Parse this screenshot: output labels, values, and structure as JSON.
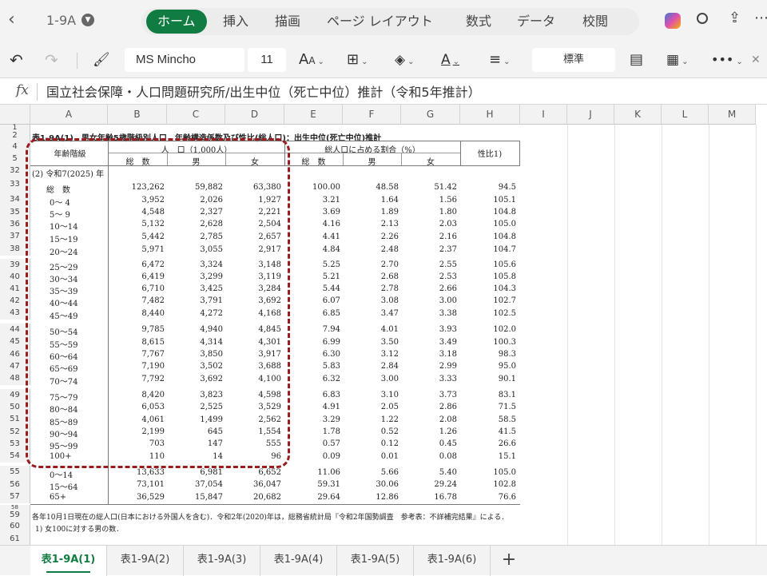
{
  "app": {
    "doc_title": "1-9A",
    "ribbon_tabs": [
      "ホーム",
      "挿入",
      "描画",
      "ページ レイアウト",
      "数式",
      "データ",
      "校閲"
    ]
  },
  "toolbar": {
    "font_name": "MS Mincho",
    "font_size": "11",
    "number_format": "標準"
  },
  "formula_bar": {
    "fx_label": "fx",
    "content": "国立社会保障・人口問題研究所/出生中位（死亡中位）推計（令和5年推計）"
  },
  "columns": [
    "A",
    "B",
    "C",
    "D",
    "E",
    "F",
    "G",
    "H",
    "I",
    "J",
    "K",
    "L",
    "M"
  ],
  "sheet": {
    "title": "表1-9A(1)　男女年齢5歳階級別人口，年齢構造係数及び性比(総人口)：出生中位(死亡中位)推計",
    "headers": {
      "age_group": "年齢階級",
      "population": "人　口（1,000人）",
      "share": "総人口に占める割合（%）",
      "sex_ratio": "性比1)",
      "total": "総　数",
      "male": "男",
      "female": "女"
    },
    "section_label": "(2) 令和7(2025) 年",
    "rows": [
      {
        "num": "33",
        "age": "総　数",
        "t": "123,262",
        "m": "59,882",
        "f": "63,380",
        "pt": "100.00",
        "pm": "48.58",
        "pf": "51.42",
        "r": "94.5"
      },
      {
        "num": "34",
        "age": "0～ 4",
        "t": "3,952",
        "m": "2,026",
        "f": "1,927",
        "pt": "3.21",
        "pm": "1.64",
        "pf": "1.56",
        "r": "105.1"
      },
      {
        "num": "35",
        "age": "5～ 9",
        "t": "4,548",
        "m": "2,327",
        "f": "2,221",
        "pt": "3.69",
        "pm": "1.89",
        "pf": "1.80",
        "r": "104.8"
      },
      {
        "num": "36",
        "age": "10～14",
        "t": "5,132",
        "m": "2,628",
        "f": "2,504",
        "pt": "4.16",
        "pm": "2.13",
        "pf": "2.03",
        "r": "105.0"
      },
      {
        "num": "37",
        "age": "15～19",
        "t": "5,442",
        "m": "2,785",
        "f": "2,657",
        "pt": "4.41",
        "pm": "2.26",
        "pf": "2.16",
        "r": "104.8"
      },
      {
        "num": "38",
        "age": "20～24",
        "t": "5,971",
        "m": "3,055",
        "f": "2,917",
        "pt": "4.84",
        "pm": "2.48",
        "pf": "2.37",
        "r": "104.7"
      },
      {
        "num": "39",
        "age": "25～29",
        "t": "6,472",
        "m": "3,324",
        "f": "3,148",
        "pt": "5.25",
        "pm": "2.70",
        "pf": "2.55",
        "r": "105.6"
      },
      {
        "num": "40",
        "age": "30～34",
        "t": "6,419",
        "m": "3,299",
        "f": "3,119",
        "pt": "5.21",
        "pm": "2.68",
        "pf": "2.53",
        "r": "105.8"
      },
      {
        "num": "41",
        "age": "35～39",
        "t": "6,710",
        "m": "3,425",
        "f": "3,284",
        "pt": "5.44",
        "pm": "2.78",
        "pf": "2.66",
        "r": "104.3"
      },
      {
        "num": "42",
        "age": "40～44",
        "t": "7,482",
        "m": "3,791",
        "f": "3,692",
        "pt": "6.07",
        "pm": "3.08",
        "pf": "3.00",
        "r": "102.7"
      },
      {
        "num": "43",
        "age": "45～49",
        "t": "8,440",
        "m": "4,272",
        "f": "4,168",
        "pt": "6.85",
        "pm": "3.47",
        "pf": "3.38",
        "r": "102.5"
      },
      {
        "num": "44",
        "age": "50～54",
        "t": "9,785",
        "m": "4,940",
        "f": "4,845",
        "pt": "7.94",
        "pm": "4.01",
        "pf": "3.93",
        "r": "102.0"
      },
      {
        "num": "45",
        "age": "55～59",
        "t": "8,615",
        "m": "4,314",
        "f": "4,301",
        "pt": "6.99",
        "pm": "3.50",
        "pf": "3.49",
        "r": "100.3"
      },
      {
        "num": "46",
        "age": "60～64",
        "t": "7,767",
        "m": "3,850",
        "f": "3,917",
        "pt": "6.30",
        "pm": "3.12",
        "pf": "3.18",
        "r": "98.3"
      },
      {
        "num": "47",
        "age": "65～69",
        "t": "7,190",
        "m": "3,502",
        "f": "3,688",
        "pt": "5.83",
        "pm": "2.84",
        "pf": "2.99",
        "r": "95.0"
      },
      {
        "num": "48",
        "age": "70～74",
        "t": "7,792",
        "m": "3,692",
        "f": "4,100",
        "pt": "6.32",
        "pm": "3.00",
        "pf": "3.33",
        "r": "90.1"
      },
      {
        "num": "49",
        "age": "75～79",
        "t": "8,420",
        "m": "3,823",
        "f": "4,598",
        "pt": "6.83",
        "pm": "3.10",
        "pf": "3.73",
        "r": "83.1"
      },
      {
        "num": "50",
        "age": "80～84",
        "t": "6,053",
        "m": "2,525",
        "f": "3,529",
        "pt": "4.91",
        "pm": "2.05",
        "pf": "2.86",
        "r": "71.5"
      },
      {
        "num": "51",
        "age": "85～89",
        "t": "4,061",
        "m": "1,499",
        "f": "2,562",
        "pt": "3.29",
        "pm": "1.22",
        "pf": "2.08",
        "r": "58.5"
      },
      {
        "num": "52",
        "age": "90～94",
        "t": "2,199",
        "m": "645",
        "f": "1,554",
        "pt": "1.78",
        "pm": "0.52",
        "pf": "1.26",
        "r": "41.5"
      },
      {
        "num": "53",
        "age": "95～99",
        "t": "703",
        "m": "147",
        "f": "555",
        "pt": "0.57",
        "pm": "0.12",
        "pf": "0.45",
        "r": "26.6"
      },
      {
        "num": "54",
        "age": "100+",
        "t": "110",
        "m": "14",
        "f": "96",
        "pt": "0.09",
        "pm": "0.01",
        "pf": "0.08",
        "r": "15.1"
      },
      {
        "num": "55",
        "age": "0～14",
        "t": "13,633",
        "m": "6,981",
        "f": "6,652",
        "pt": "11.06",
        "pm": "5.66",
        "pf": "5.40",
        "r": "105.0"
      },
      {
        "num": "56",
        "age": "15～64",
        "t": "73,101",
        "m": "37,054",
        "f": "36,047",
        "pt": "59.31",
        "pm": "30.06",
        "pf": "29.24",
        "r": "102.8"
      },
      {
        "num": "57",
        "age": "65+",
        "t": "36,529",
        "m": "15,847",
        "f": "20,682",
        "pt": "29.64",
        "pm": "12.86",
        "pf": "16.78",
        "r": "76.6"
      }
    ],
    "note1": "各年10月1日現在の総人口(日本における外国人を含む)．令和2年(2020)年は，総務省統計局『令和2年国勢調査　参考表：不詳補完結果』による．",
    "note2": "1) 女100に対する男の数．"
  },
  "sheet_tabs": [
    "表1-9A(1)",
    "表1-9A(2)",
    "表1-9A(3)",
    "表1-9A(4)",
    "表1-9A(5)",
    "表1-9A(6)"
  ],
  "colors": {
    "accent": "#107c41",
    "highlight": "#9b1c1c"
  }
}
